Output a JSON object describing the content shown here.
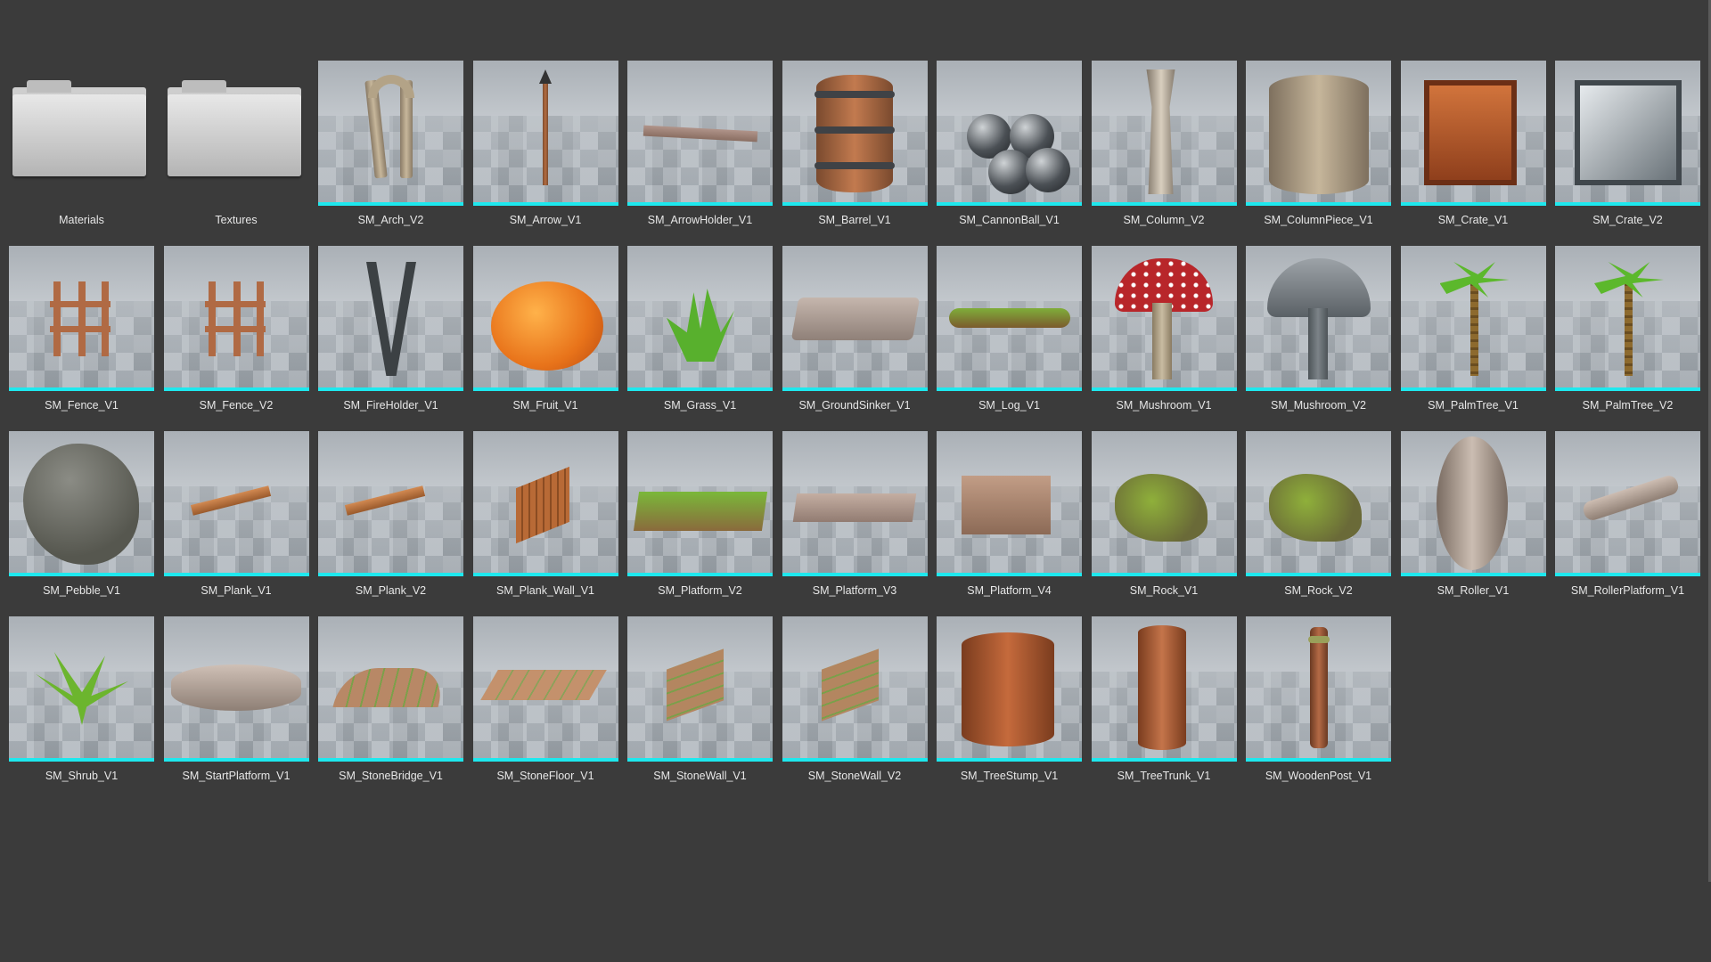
{
  "folders": [
    {
      "label": "Materials",
      "icon": "folder-icon"
    },
    {
      "label": "Textures",
      "icon": "folder-icon"
    }
  ],
  "assets": [
    {
      "label": "SM_Arch_V2",
      "icon": "arch-icon"
    },
    {
      "label": "SM_Arrow_V1",
      "icon": "arrow-icon"
    },
    {
      "label": "SM_ArrowHolder_V1",
      "icon": "beam-icon"
    },
    {
      "label": "SM_Barrel_V1",
      "icon": "barrel-icon"
    },
    {
      "label": "SM_CannonBall_V1",
      "icon": "cannonball-icon"
    },
    {
      "label": "SM_Column_V2",
      "icon": "column-icon"
    },
    {
      "label": "SM_ColumnPiece_V1",
      "icon": "column-piece-icon"
    },
    {
      "label": "SM_Crate_V1",
      "icon": "crate-icon"
    },
    {
      "label": "SM_Crate_V2",
      "icon": "metal-crate-icon"
    },
    {
      "label": "SM_Fence_V1",
      "icon": "fence-icon"
    },
    {
      "label": "SM_Fence_V2",
      "icon": "fence-icon"
    },
    {
      "label": "SM_FireHolder_V1",
      "icon": "fire-holder-icon"
    },
    {
      "label": "SM_Fruit_V1",
      "icon": "fruit-icon"
    },
    {
      "label": "SM_Grass_V1",
      "icon": "grass-icon"
    },
    {
      "label": "SM_GroundSinker_V1",
      "icon": "ground-sinker-icon"
    },
    {
      "label": "SM_Log_V1",
      "icon": "log-icon"
    },
    {
      "label": "SM_Mushroom_V1",
      "icon": "mushroom-icon"
    },
    {
      "label": "SM_Mushroom_V2",
      "icon": "mushroom-gray-icon"
    },
    {
      "label": "SM_PalmTree_V1",
      "icon": "palm-tree-icon"
    },
    {
      "label": "SM_PalmTree_V2",
      "icon": "palm-tree-icon"
    },
    {
      "label": "SM_Pebble_V1",
      "icon": "pebble-icon"
    },
    {
      "label": "SM_Plank_V1",
      "icon": "plank-icon"
    },
    {
      "label": "SM_Plank_V2",
      "icon": "plank-icon"
    },
    {
      "label": "SM_Plank_Wall_V1",
      "icon": "plank-wall-icon"
    },
    {
      "label": "SM_Platform_V2",
      "icon": "grass-platform-icon"
    },
    {
      "label": "SM_Platform_V3",
      "icon": "stone-platform-icon"
    },
    {
      "label": "SM_Platform_V4",
      "icon": "stone-block-icon"
    },
    {
      "label": "SM_Rock_V1",
      "icon": "mossy-rock-icon"
    },
    {
      "label": "SM_Rock_V2",
      "icon": "mossy-rock-icon"
    },
    {
      "label": "SM_Roller_V1",
      "icon": "roller-icon"
    },
    {
      "label": "SM_RollerPlatform_V1",
      "icon": "roller-platform-icon"
    },
    {
      "label": "SM_Shrub_V1",
      "icon": "shrub-icon"
    },
    {
      "label": "SM_StartPlatform_V1",
      "icon": "start-platform-icon"
    },
    {
      "label": "SM_StoneBridge_V1",
      "icon": "stone-bridge-icon"
    },
    {
      "label": "SM_StoneFloor_V1",
      "icon": "stone-floor-icon"
    },
    {
      "label": "SM_StoneWall_V1",
      "icon": "stone-wall-icon"
    },
    {
      "label": "SM_StoneWall_V2",
      "icon": "stone-wall-icon"
    },
    {
      "label": "SM_TreeStump_V1",
      "icon": "tree-stump-icon"
    },
    {
      "label": "SM_TreeTrunk_V1",
      "icon": "tree-trunk-icon"
    },
    {
      "label": "SM_WoodenPost_V1",
      "icon": "wooden-post-icon"
    }
  ],
  "colors": {
    "background": "#3b3b3b",
    "selection_bar": "#1ee8ee",
    "label_text": "#e7e7e7"
  }
}
